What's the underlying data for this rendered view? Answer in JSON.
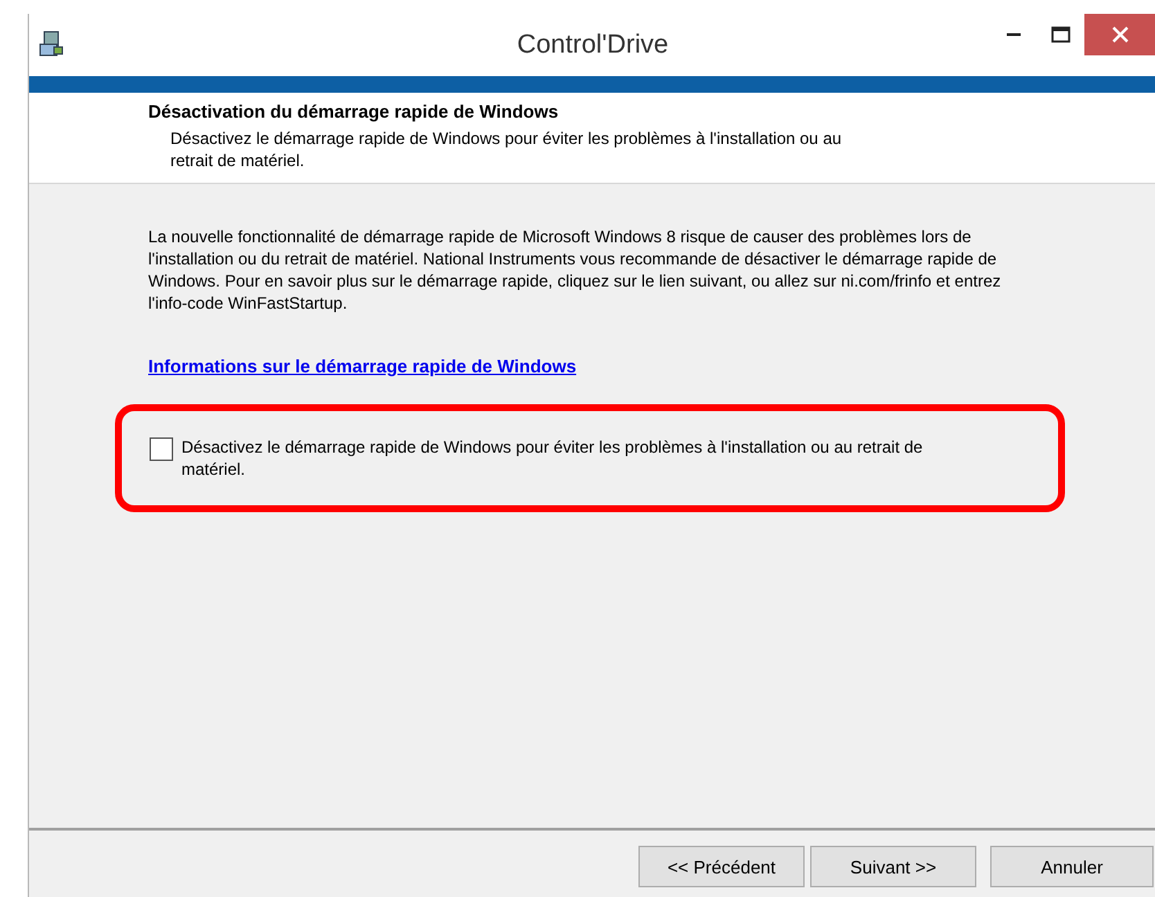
{
  "window": {
    "title": "Control'Drive"
  },
  "header": {
    "title": "Désactivation du démarrage rapide de Windows",
    "subtitle": "Désactivez le démarrage rapide de Windows pour éviter les problèmes à l'installation ou au retrait de matériel."
  },
  "body": {
    "paragraph": "La nouvelle fonctionnalité de démarrage rapide de Microsoft Windows 8 risque de causer des problèmes lors de l'installation ou du retrait de matériel. National Instruments vous recommande de désactiver le démarrage rapide de Windows. Pour en savoir plus sur le démarrage rapide, cliquez sur le lien suivant, ou allez sur ni.com/frinfo et entrez l'info-code WinFastStartup.",
    "link": "Informations sur le démarrage rapide de Windows",
    "checkbox": {
      "label": "Désactivez le démarrage rapide de Windows pour éviter les problèmes à l'installation ou au retrait de matériel.",
      "checked": false,
      "highlighted": true
    }
  },
  "buttons": [
    {
      "label": "<< Précédent"
    },
    {
      "label": "Suivant >>"
    },
    {
      "label": "Annuler"
    }
  ]
}
